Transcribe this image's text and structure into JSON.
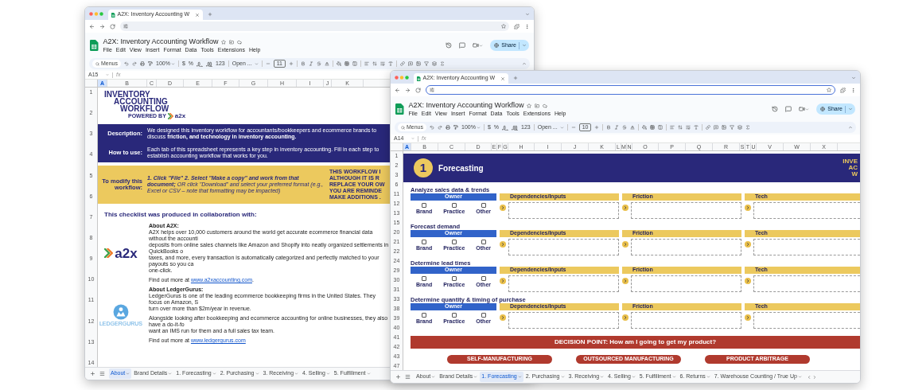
{
  "windows": [
    {
      "kind": "about",
      "browser_tab": "A2X: Inventory Accounting W",
      "address_focused": false,
      "doc_title": "A2X: Inventory Accounting Workflow",
      "menu": [
        "File",
        "Edit",
        "View",
        "Insert",
        "Format",
        "Data",
        "Tools",
        "Extensions",
        "Help"
      ],
      "toolbar": {
        "search": "Menus",
        "zoom": "100%",
        "currency": "$",
        "percent": "%",
        "number_format": "123",
        "font": "Open ...",
        "font_size": "11"
      },
      "share": "Share",
      "name_box": "A15",
      "formula_label": "fx",
      "columns": [
        {
          "label": "A",
          "selected": true
        },
        {
          "label": "B",
          "selected": false
        },
        {
          "label": "C",
          "selected": false
        },
        {
          "label": "D",
          "selected": false
        },
        {
          "label": "E",
          "selected": false
        },
        {
          "label": "F",
          "selected": false
        },
        {
          "label": "G",
          "selected": false
        },
        {
          "label": "H",
          "selected": false
        },
        {
          "label": "I",
          "selected": false
        },
        {
          "label": "J",
          "selected": false
        },
        {
          "label": "K",
          "selected": false
        }
      ],
      "rows": [
        "1",
        "2",
        "3",
        "4",
        "5",
        "6",
        "7",
        "8",
        "9",
        "10",
        "11",
        "12",
        "13",
        "14"
      ],
      "content": {
        "logo": {
          "lines": [
            "INVENTORY",
            "ACCOUNTING",
            "WORKFLOW"
          ],
          "powered_by": "POWERED BY",
          "brand": "a2x"
        },
        "bands": [
          {
            "kind": "dark",
            "label": "Description:",
            "text": "We designed this inventory workflow for accountants/bookkeepers and ecommerce brands to discuss **friction, and technology in inventory accounting.**"
          },
          {
            "kind": "dark",
            "label": "How to use:",
            "text": "Each tab of this spreadsheet represents a key step in inventory accounting. Fill in each step to establish accounting workflow that works for you."
          },
          {
            "kind": "yellow",
            "label": "To modify this workflow:",
            "text": "**1. Click \"File\"** **2. Select \"Make a copy\" and work from that document;** OR click \"Download\" and select your preferred format (e.g., Excel or CSV – note that formatting may be impacted)",
            "notice": [
              "THIS WORKFLOW I",
              "ALTHOUGH IT IS R",
              "REPLACE YOUR OW",
              "YOU ARE REMINDE",
              "MAKE ADDITIONS ."
            ]
          }
        ],
        "heading": "This checklist was produced in collaboration with:",
        "partners": [
          {
            "kind": "a2x",
            "logo_text": "a2x",
            "title": "About A2X:",
            "lines": [
              "A2X helps over 10,000 customers around the world get accurate ecommerce financial data without the accounti",
              "deposits from online sales channels like Amazon and Shopify into neatly organized settlements in QuickBooks o",
              "taxes, and more, every transaction is automatically categorized and perfectly matched to your payouts so you ca",
              "one-click."
            ],
            "more": "Find out more at",
            "link": "www.a2xaccounting.com",
            "after_link": "."
          },
          {
            "kind": "ledgergurus",
            "logo_text": "LEDGERGURUS",
            "title": "About LedgerGurus:",
            "lines": [
              "LedgerGurus is one of the leading ecommerce bookkeeping firms in the United States. They focus on Amazon, S",
              "turn over more than $2m/year in revenue.",
              "Alongside looking after bookkeeping and ecommerce accounting for online businesses, they also have a do-it-fo",
              "want an IMS run for them and a full sales tax team."
            ],
            "more": "Find out more at",
            "link": "www.ledgergurus.com"
          }
        ]
      },
      "sheet_tabs": [
        {
          "label": "About",
          "selected": true
        },
        {
          "label": "Brand Details",
          "selected": false
        },
        {
          "label": "1. Forecasting",
          "selected": false
        },
        {
          "label": "2. Purchasing",
          "selected": false
        },
        {
          "label": "3. Receiving",
          "selected": false
        },
        {
          "label": "4. Selling",
          "selected": false
        },
        {
          "label": "5. Fulfillment",
          "selected": false
        }
      ]
    },
    {
      "kind": "forecasting",
      "browser_tab": "A2X: Inventory Accounting W",
      "address_focused": true,
      "doc_title": "A2X: Inventory Accounting Workflow",
      "menu": [
        "File",
        "Edit",
        "View",
        "Insert",
        "Format",
        "Data",
        "Tools",
        "Extensions",
        "Help"
      ],
      "toolbar": {
        "search": "Menus",
        "zoom": "100%",
        "currency": "$",
        "percent": "%",
        "number_format": "123",
        "font": "Open ...",
        "font_size": "10"
      },
      "share": "Share",
      "name_box": "A14",
      "formula_label": "fx",
      "columns": [
        {
          "label": "A",
          "selected": true
        },
        {
          "label": "B",
          "selected": false
        },
        {
          "label": "C",
          "selected": false
        },
        {
          "label": "D",
          "selected": false
        },
        {
          "label": "E",
          "selected": false
        },
        {
          "label": "F",
          "selected": false
        },
        {
          "label": "G",
          "selected": false
        },
        {
          "label": "H",
          "selected": false
        },
        {
          "label": "I",
          "selected": false
        },
        {
          "label": "J",
          "selected": false
        },
        {
          "label": "K",
          "selected": false
        },
        {
          "label": "L",
          "selected": false
        },
        {
          "label": "M",
          "selected": false
        },
        {
          "label": "N",
          "selected": false
        },
        {
          "label": "O",
          "selected": false
        },
        {
          "label": "P",
          "selected": false
        },
        {
          "label": "Q",
          "selected": false
        },
        {
          "label": "R",
          "selected": false
        },
        {
          "label": "S",
          "selected": false
        },
        {
          "label": "T",
          "selected": false
        },
        {
          "label": "U",
          "selected": false
        },
        {
          "label": "V",
          "selected": false
        },
        {
          "label": "W",
          "selected": false
        },
        {
          "label": "X",
          "selected": false
        }
      ],
      "rows": [
        "1",
        "2",
        "3",
        "6",
        "11",
        "12",
        "13",
        "15",
        "20",
        "21",
        "22",
        "24",
        "29",
        "30",
        "31",
        "33",
        "38",
        "39",
        "40",
        "41",
        "42",
        "43",
        "47"
      ],
      "content": {
        "step": "1",
        "title": "Forecasting",
        "logo_lines": [
          "INVE",
          "AC",
          "W"
        ],
        "sections": [
          {
            "title": "Analyze sales data & trends",
            "owner": "Owner",
            "options": [
              {
                "label": "Brand",
                "checked": false
              },
              {
                "label": "Practice",
                "checked": false
              },
              {
                "label": "Other",
                "checked": false
              }
            ],
            "fields": [
              "Dependencies/Inputs",
              "Friction",
              "Tech"
            ]
          },
          {
            "title": "Forecast demand",
            "owner": "Owner",
            "options": [
              {
                "label": "Brand",
                "checked": false
              },
              {
                "label": "Practice",
                "checked": false
              },
              {
                "label": "Other",
                "checked": false
              }
            ],
            "fields": [
              "Dependencies/Inputs",
              "Friction",
              "Tech"
            ]
          },
          {
            "title": "Determine lead times",
            "owner": "Owner",
            "options": [
              {
                "label": "Brand",
                "checked": false
              },
              {
                "label": "Practice",
                "checked": false
              },
              {
                "label": "Other",
                "checked": false
              }
            ],
            "fields": [
              "Dependencies/Inputs",
              "Friction",
              "Tech"
            ]
          },
          {
            "title": "Determine quantity & timing of purchase",
            "owner": "Owner",
            "options": [
              {
                "label": "Brand",
                "checked": false
              },
              {
                "label": "Practice",
                "checked": false
              },
              {
                "label": "Other",
                "checked": false
              }
            ],
            "fields": [
              "Dependencies/Inputs",
              "Friction",
              "Tech"
            ]
          }
        ],
        "decision": {
          "text": "DECISION POINT: How am I going to get my product?",
          "options": [
            "SELF-MANUFACTURING",
            "OUTSOURCED MANUFACTURING",
            "PRODUCT ARBITRAGE"
          ]
        }
      },
      "sheet_tabs": [
        {
          "label": "About",
          "selected": false
        },
        {
          "label": "Brand Details",
          "selected": false
        },
        {
          "label": "1. Forecasting",
          "selected": true
        },
        {
          "label": "2. Purchasing",
          "selected": false
        },
        {
          "label": "3. Receiving",
          "selected": false
        },
        {
          "label": "4. Selling",
          "selected": false
        },
        {
          "label": "5. Fulfillment",
          "selected": false
        },
        {
          "label": "6. Returns",
          "selected": false
        },
        {
          "label": "7. Warehouse Counting / True Up",
          "selected": false
        }
      ],
      "tab_scroll_arrows": true
    }
  ]
}
